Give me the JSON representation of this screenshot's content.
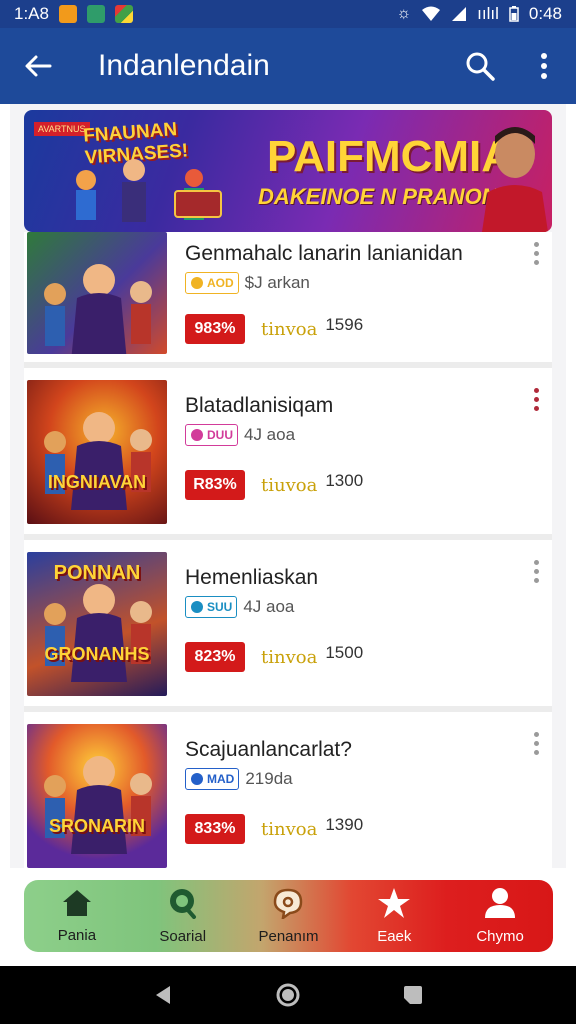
{
  "status_bar": {
    "time_left": "1:A8",
    "signal": "ıılıl",
    "time_right": "0:48"
  },
  "app_bar": {
    "title": "Indanlendain"
  },
  "banner": {
    "left_text": "FNAUNAN\nVIRNASES!",
    "tag": "AVARTNUS",
    "title": "PAIFMCMIA",
    "subtitle": "DAKEINOE N PRANONI!"
  },
  "items": [
    {
      "title": "Genmahalc lanarin lanianidan",
      "brand": "AOD",
      "meta": "$J arkan",
      "discount": "983%",
      "stat_label": "tinvoa",
      "stat_count": "1596",
      "thumb_text": "",
      "brand_color": "#f0b323",
      "thumb_bg": "linear-gradient(135deg,#2f7a3a,#4a3a9a 55%,#d24a2a)"
    },
    {
      "title": "Blatadlanisiqam",
      "brand": "DUU",
      "meta": "4J aoa",
      "discount": "R83%",
      "stat_label": "tiuvoa",
      "stat_count": "1300",
      "thumb_text": "INGNIAVAN",
      "brand_color": "#d23b9a",
      "thumb_bg": "radial-gradient(circle at 55% 35%,#f6b12b,#d2451c 45%,#5a0f14)"
    },
    {
      "title": "Hemenliaskan",
      "brand": "SUU",
      "meta": "4J aoa",
      "discount": "823%",
      "stat_label": "tinvoa",
      "stat_count": "1500",
      "thumb_text": "GRONANHS",
      "brand_color": "#1a8ec2",
      "thumb_bg": "linear-gradient(160deg,#2a3f9e,#c2522a 60%,#241b5a)"
    },
    {
      "title": "Scajuanlancarlat?",
      "brand": "MAD",
      "meta": "219da",
      "discount": "833%",
      "stat_label": "tinvoa",
      "stat_count": "1390",
      "thumb_text": "SRONARIN",
      "brand_color": "#2460c9",
      "thumb_bg": "radial-gradient(circle at 50% 30%,#ffd03a,#e25a2a 40%,#5b2a9a 75%)"
    }
  ],
  "thumb_top_text": {
    "item3": "PONNAN"
  },
  "bottom_nav": [
    {
      "label": "Pania",
      "icon": "home-icon"
    },
    {
      "label": "Soarial",
      "icon": "search-icon"
    },
    {
      "label": "Penanım",
      "icon": "chat-icon"
    },
    {
      "label": "Eaek",
      "icon": "star-icon"
    },
    {
      "label": "Chymo",
      "icon": "person-icon"
    }
  ]
}
